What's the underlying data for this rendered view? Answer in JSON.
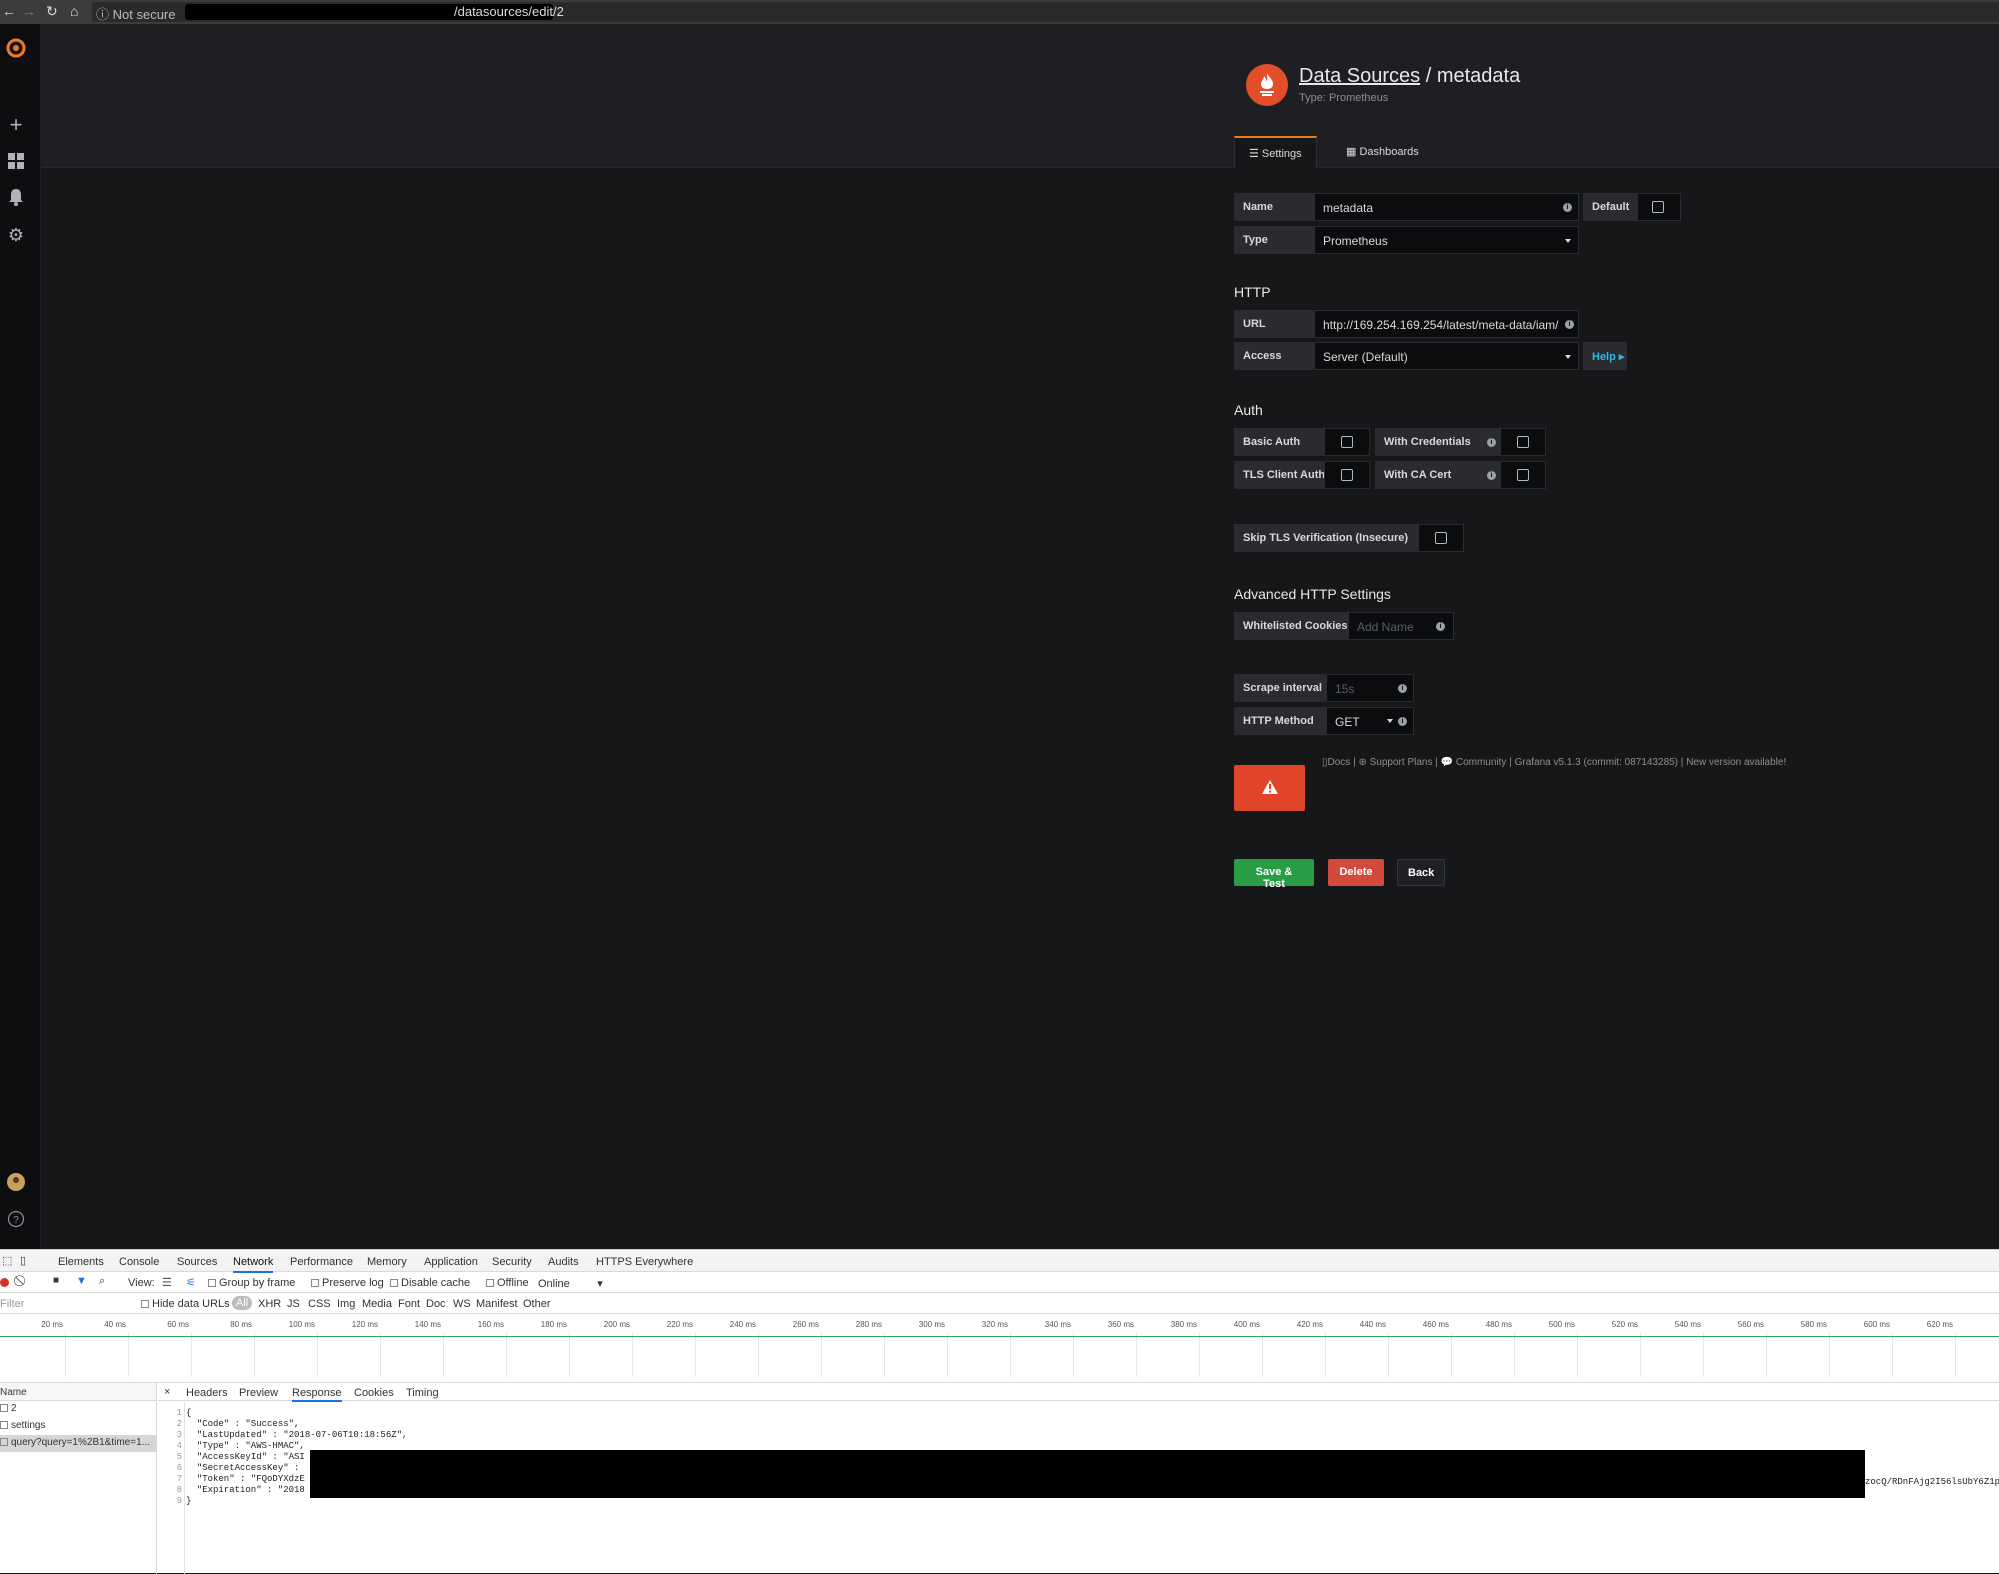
{
  "browser": {
    "security_label": "Not secure",
    "url_visible": "/datasources/edit/2"
  },
  "header": {
    "breadcrumb_link": "Data Sources",
    "breadcrumb_sep": " / ",
    "page_name": "metadata",
    "subtitle": "Type: Prometheus"
  },
  "tabs": [
    {
      "label": "Settings"
    },
    {
      "label": "Dashboards"
    }
  ],
  "form": {
    "name_label": "Name",
    "name_value": "metadata",
    "default_label": "Default",
    "type_label": "Type",
    "type_value": "Prometheus",
    "http_heading": "HTTP",
    "url_label": "URL",
    "url_value": "http://169.254.169.254/latest/meta-data/iam/",
    "access_label": "Access",
    "access_value": "Server (Default)",
    "help_label": "Help ▸",
    "auth_heading": "Auth",
    "basic_auth": "Basic Auth",
    "with_credentials": "With Credentials",
    "tls_client_auth": "TLS Client Auth",
    "with_ca_cert": "With CA Cert",
    "skip_tls": "Skip TLS Verification (Insecure)",
    "advanced_heading": "Advanced HTTP Settings",
    "cookies_label": "Whitelisted Cookies",
    "cookies_placeholder": "Add Name",
    "scrape_label": "Scrape interval",
    "scrape_placeholder": "15s",
    "method_label": "HTTP Method",
    "method_value": "GET"
  },
  "buttons": {
    "save_test": "Save & Test",
    "delete": "Delete",
    "back": "Back"
  },
  "footer": {
    "docs": "Docs",
    "support": "Support Plans",
    "community": "Community",
    "version": "Grafana v5.1.3 (commit: 087143285)",
    "new_version": "New version available!"
  },
  "devtools": {
    "tabs": [
      "Elements",
      "Console",
      "Sources",
      "Network",
      "Performance",
      "Memory",
      "Application",
      "Security",
      "Audits",
      "HTTPS Everywhere"
    ],
    "active_tab": "Network",
    "toolbar": {
      "view": "View:",
      "group_by_frame": "Group by frame",
      "preserve_log": "Preserve log",
      "disable_cache": "Disable cache",
      "offline": "Offline",
      "online": "Online"
    },
    "filter": {
      "placeholder": "Filter",
      "hide_data_urls": "Hide data URLs",
      "types": [
        "All",
        "XHR",
        "JS",
        "CSS",
        "Img",
        "Media",
        "Font",
        "Doc",
        "WS",
        "Manifest",
        "Other"
      ]
    },
    "timeline_ticks": [
      "20 ms",
      "40 ms",
      "60 ms",
      "80 ms",
      "100 ms",
      "120 ms",
      "140 ms",
      "160 ms",
      "180 ms",
      "200 ms",
      "220 ms",
      "240 ms",
      "260 ms",
      "280 ms",
      "300 ms",
      "320 ms",
      "340 ms",
      "360 ms",
      "380 ms",
      "400 ms",
      "420 ms",
      "440 ms",
      "460 ms",
      "480 ms",
      "500 ms",
      "520 ms",
      "540 ms",
      "560 ms",
      "580 ms",
      "600 ms",
      "620 ms"
    ],
    "name_header": "Name",
    "requests": [
      "2",
      "settings",
      "query?query=1%2B1&time=1..."
    ],
    "detail_tabs": [
      "Headers",
      "Preview",
      "Response",
      "Cookies",
      "Timing"
    ],
    "active_detail_tab": "Response",
    "response_lines": [
      "{",
      "  \"Code\" : \"Success\",",
      "  \"LastUpdated\" : \"2018-07-06T10:18:56Z\",",
      "  \"Type\" : \"AWS-HMAC\",",
      "  \"AccessKeyId\" : \"ASI",
      "  \"SecretAccessKey\" :",
      "  \"Token\" : \"FQoDYXdzE",
      "  \"Expiration\" : \"2018",
      "}"
    ],
    "token_tail": "zocQ/RDnFAjg2I56lsUbY6Z1p"
  }
}
